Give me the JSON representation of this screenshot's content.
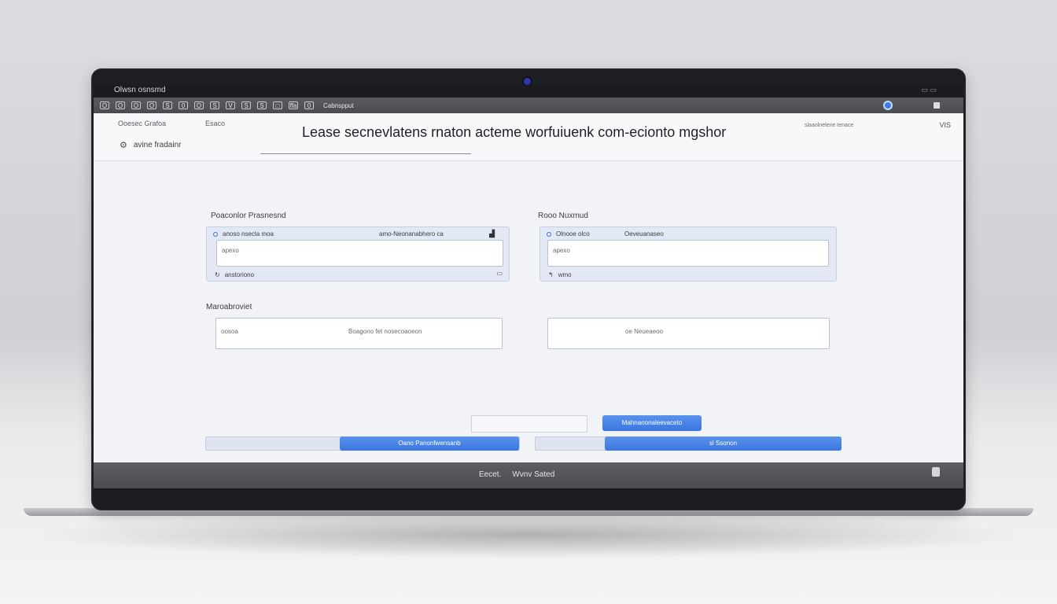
{
  "window": {
    "title": "Olwsn   osnsmd",
    "controls": "▭ ▭"
  },
  "toolbar": {
    "icons": [
      "O",
      "O",
      "O",
      "O",
      "S",
      "0",
      "O",
      "S",
      "V",
      "S",
      "S",
      "□",
      "ffa",
      "0"
    ],
    "label": "Cabnspput"
  },
  "header": {
    "nav_left": "Ooesec  Grafoa",
    "nav_mid": "Esaco",
    "breadcrumb": "avine  fradainr",
    "title": "Lease secnevlatens rnaton acteme worfuiuenk com-ecionto mgshor",
    "right_text": "slaaolnelene tenace",
    "close": "VIS"
  },
  "left_panel": {
    "label": "Poaconlor Prasnesnd",
    "card": {
      "top_left": "anoso nsecla moa",
      "top_right": "amo-Neonanabhero ca",
      "input_placeholder": "apexo",
      "bottom_left": "anstoriono"
    },
    "field_label": "Maroabroviet",
    "field": {
      "placeholder": "oosoa",
      "value": "Boagono fet nosecoaoeon"
    },
    "button_label": "Oano  Panonfwensanb"
  },
  "right_panel": {
    "label": "Rooo Nuxmud",
    "card": {
      "top_left": "Olnooe olco",
      "top_right": "Oeveuanaseo",
      "input_placeholder": "apexo",
      "bottom_left": "wmo"
    },
    "field": {
      "value": "oe Neueaeoo"
    },
    "button_label": "sl  Ssonon"
  },
  "actions": {
    "submit_label": "Mahnanonaleevaceto"
  },
  "footer": {
    "left": "Eecet.",
    "right": "Wvnv Sated"
  },
  "colors": {
    "accent": "#3a76e0",
    "screen_bg": "#eef0f4",
    "bezel": "#1e1f22"
  }
}
